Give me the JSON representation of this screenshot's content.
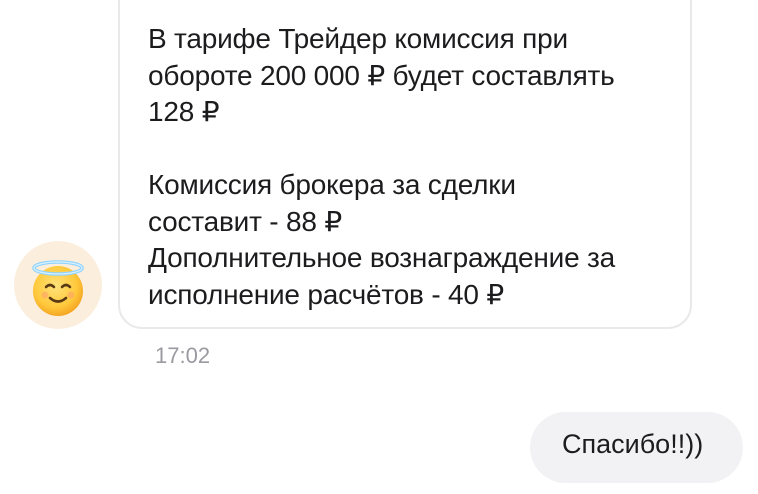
{
  "incoming_message": {
    "text": "В тарифе Трейдер комиссия при\nобороте 200 000 ₽ будет составлять\n128 ₽\n\nКомиссия брокера за сделки\nсоставит - 88 ₽\nДополнительное вознаграждение за\nисполнение расчётов - 40 ₽",
    "time": "17:02",
    "avatar_icon": "halo-smiley-icon"
  },
  "outgoing_message": {
    "text": "Спасибо!!))"
  },
  "colors": {
    "bubble_border": "#e9e9ec",
    "outgoing_bubble": "#f2f2f4",
    "avatar_bg": "#fbeedd",
    "timestamp": "#9a9aa0",
    "text": "#1c1c1e"
  }
}
